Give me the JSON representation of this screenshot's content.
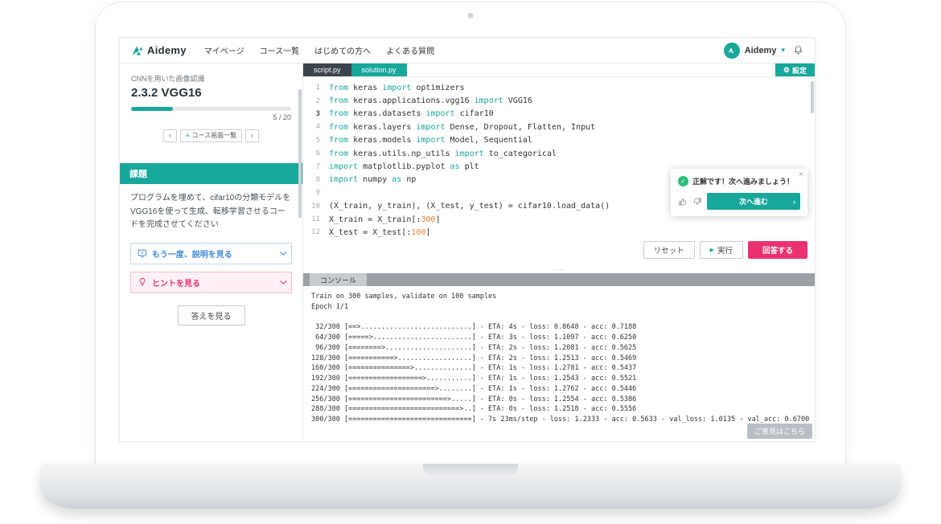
{
  "colors": {
    "accent_teal": "#17a79b",
    "accent_pink": "#e9326e",
    "active_tab_dark": "#3d444c",
    "success_green": "#2dbd78",
    "console_bar_gray": "#9aa0a6"
  },
  "icons": {
    "gear": "⚙",
    "play": "▶",
    "prev": "‹",
    "next": "›",
    "check": "✓",
    "close": "×",
    "caret_down": "▾",
    "list": "≡",
    "handle_dots": "⋯⋯",
    "arrow_right": "›"
  },
  "nav": {
    "logo_text": "Aidemy",
    "menu_items": [
      "マイページ",
      "コース一覧",
      "はじめての方へ",
      "よくある質問"
    ],
    "account_name": "Aidemy"
  },
  "sidebar": {
    "course_title": "CNNを用いた画像認識",
    "lesson_title": "2.3.2 VGG16",
    "progress_current": 5,
    "progress_total": 20,
    "progress_label": "5 / 20",
    "progress_percent": 26,
    "pager": {
      "list_label": "コース画面一覧"
    },
    "task_header": "課題",
    "task_description": "プログラムを埋めて、cifar10の分類モデルをVGG16を使って生成、転移学習させるコードを完成させてください",
    "explain_label": "もう一度、説明を見る",
    "hint_label": "ヒントを見る",
    "answer_label": "答えを見る"
  },
  "editor": {
    "tabs": [
      {
        "label": "script.py",
        "active": true
      },
      {
        "label": "solution.py",
        "active": false
      }
    ],
    "settings_label": "設定",
    "code_lines": [
      {
        "num": 1,
        "tokens": [
          [
            "from",
            "k"
          ],
          [
            " keras ",
            "p"
          ],
          [
            "import",
            "k"
          ],
          [
            " optimizers",
            "p"
          ]
        ]
      },
      {
        "num": 2,
        "tokens": [
          [
            "from",
            "k"
          ],
          [
            " keras.applications.vgg16 ",
            "p"
          ],
          [
            "import",
            "k"
          ],
          [
            " VGG16",
            "p"
          ]
        ]
      },
      {
        "num": 3,
        "active": true,
        "tokens": [
          [
            "from",
            "k"
          ],
          [
            " keras.datasets ",
            "p"
          ],
          [
            "import",
            "k"
          ],
          [
            " cifar10",
            "p"
          ]
        ]
      },
      {
        "num": 4,
        "tokens": [
          [
            "from",
            "k"
          ],
          [
            " keras.layers ",
            "p"
          ],
          [
            "import",
            "k"
          ],
          [
            " Dense, Dropout, Flatten, Input",
            "p"
          ]
        ]
      },
      {
        "num": 5,
        "tokens": [
          [
            "from",
            "k"
          ],
          [
            " keras.models ",
            "p"
          ],
          [
            "import",
            "k"
          ],
          [
            " Model, Sequential",
            "p"
          ]
        ]
      },
      {
        "num": 6,
        "tokens": [
          [
            "from",
            "k"
          ],
          [
            " keras.utils.np_utils ",
            "p"
          ],
          [
            "import",
            "k"
          ],
          [
            " to_categorical",
            "p"
          ]
        ]
      },
      {
        "num": 7,
        "tokens": [
          [
            "import",
            "k"
          ],
          [
            " matplotlib.pyplot ",
            "p"
          ],
          [
            "as",
            "k"
          ],
          [
            " plt",
            "p"
          ]
        ]
      },
      {
        "num": 8,
        "tokens": [
          [
            "import",
            "k"
          ],
          [
            " numpy ",
            "p"
          ],
          [
            "as",
            "k"
          ],
          [
            " np",
            "p"
          ]
        ]
      },
      {
        "num": 9,
        "tokens": []
      },
      {
        "num": 10,
        "tokens": [
          [
            "(X_train, y_train), (X_test, y_test) = cifar10.load_data()",
            "p"
          ]
        ]
      },
      {
        "num": 11,
        "tokens": [
          [
            "X_train = X_train[:",
            "p"
          ],
          [
            "300",
            "n"
          ],
          [
            "]",
            "p"
          ]
        ]
      },
      {
        "num": 12,
        "tokens": [
          [
            "X_test = X_test[:",
            "p"
          ],
          [
            "100",
            "n"
          ],
          [
            "]",
            "p"
          ]
        ]
      }
    ],
    "actions": {
      "reset": "リセット",
      "run": "実行",
      "submit": "回答する"
    }
  },
  "toast": {
    "message": "正解です！次へ進みましょう！",
    "next_label": "次へ進む"
  },
  "console": {
    "tab_label": "コンソール",
    "lines": [
      "Train on 300 samples, validate on 100 samples",
      "Epoch 1/1",
      "",
      " 32/300 [==>...........................] - ETA: 4s - loss: 0.8648 - acc: 0.7188",
      " 64/300 [=====>........................] - ETA: 3s - loss: 1.1097 - acc: 0.6250",
      " 96/300 [========>.....................] - ETA: 2s - loss: 1.2081 - acc: 0.5625",
      "128/300 [===========>..................] - ETA: 2s - loss: 1.2513 - acc: 0.5469",
      "160/300 [===============>..............] - ETA: 1s - loss: 1.2781 - acc: 0.5437",
      "192/300 [==================>...........] - ETA: 1s - loss: 1.2543 - acc: 0.5521",
      "224/300 [=====================>........] - ETA: 1s - loss: 1.2762 - acc: 0.5446",
      "256/300 [========================>.....] - ETA: 0s - loss: 1.2554 - acc: 0.5386",
      "288/300 [===========================>..] - ETA: 0s - loss: 1.2518 - acc: 0.5556",
      "300/300 [==============================] - 7s 23ms/step - loss: 1.2333 - acc: 0.5633 - val_loss: 1.0135 - val_acc: 0.6700"
    ]
  },
  "feedback_label": "ご意見はこちら"
}
